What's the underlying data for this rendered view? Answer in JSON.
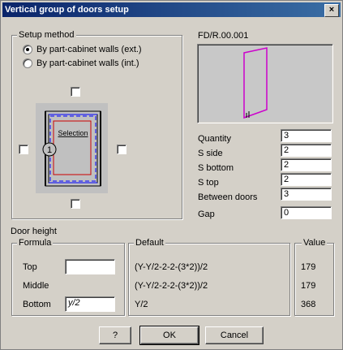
{
  "window": {
    "title": "Vertical group of doors setup",
    "close_glyph": "×"
  },
  "setup_method": {
    "legend": "Setup method",
    "options": [
      {
        "label": "By part-cabinet walls (ext.)",
        "selected": true
      },
      {
        "label": "By part-cabinet walls (int.)",
        "selected": false
      }
    ],
    "schematic_label": "Selection",
    "schematic_marker": "1"
  },
  "preview": {
    "code": "FD/R.00.001",
    "panel_color": "#c8c8c8",
    "door_color": "#cc00cc"
  },
  "params": [
    {
      "label": "Quantity",
      "value": "3"
    },
    {
      "label": "S side",
      "value": "2"
    },
    {
      "label": "S bottom",
      "value": "2"
    },
    {
      "label": "S top",
      "value": "2"
    },
    {
      "label": "Between doors",
      "value": "3"
    },
    {
      "label": "Gap",
      "value": "0"
    }
  ],
  "door_height": {
    "title": "Door height",
    "formula_legend": "Formula",
    "default_legend": "Default",
    "value_legend": "Value",
    "rows": [
      {
        "label": "Top",
        "input": "",
        "default": "(Y-Y/2-2-2-(3*2))/2",
        "value": "179"
      },
      {
        "label": "Middle",
        "default": "(Y-Y/2-2-2-(3*2))/2",
        "value": "179"
      },
      {
        "label": "Bottom",
        "input": "y/2",
        "default": "Y/2",
        "value": "368"
      }
    ]
  },
  "buttons": {
    "help": "?",
    "ok": "OK",
    "cancel": "Cancel"
  }
}
